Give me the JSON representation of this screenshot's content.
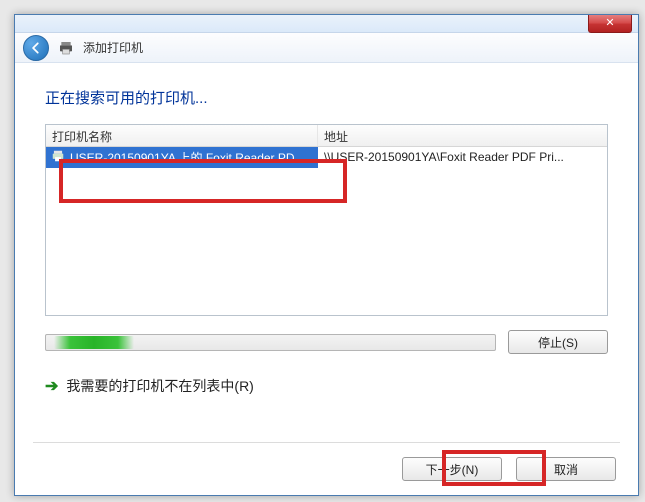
{
  "titlebar": {
    "close_glyph": "✕"
  },
  "breadcrumb": {
    "title": "添加打印机"
  },
  "heading": "正在搜索可用的打印机...",
  "columns": {
    "name": "打印机名称",
    "address": "地址"
  },
  "rows": [
    {
      "name": "USER-20150901YA 上的 Foxit Reader PD...",
      "address": "\\\\USER-20150901YA\\Foxit Reader PDF Pri..."
    }
  ],
  "buttons": {
    "stop": "停止(S)",
    "next": "下一步(N)",
    "cancel": "取消"
  },
  "link": {
    "text": "我需要的打印机不在列表中(R)"
  }
}
